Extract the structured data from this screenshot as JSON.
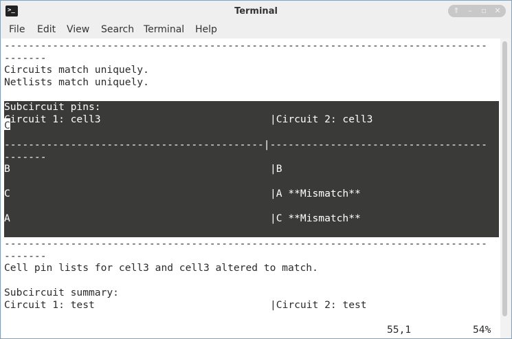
{
  "window": {
    "title": "Terminal",
    "icon": "terminal-icon"
  },
  "controls": {
    "up": "⇑",
    "minimize": "–",
    "maximize": "▫",
    "close": "✕"
  },
  "menu": [
    "File",
    "Edit",
    "View",
    "Search",
    "Terminal",
    "Help"
  ],
  "terminal": {
    "dash_row": "--------------------------------------------------------------------------------",
    "dash_tail": "-------",
    "circuits_match": "Circuits match uniquely.",
    "netlists_match": "Netlists match uniquely.",
    "subckt_pins": "Subcircuit pins:",
    "pins_header_left": "Circuit 1: cell3",
    "pins_header_right": "|Circuit 2: cell3",
    "pins_sep": "-------------------------------------------|------------------------------------",
    "pin_b_left": "B",
    "pin_b_right": "|B",
    "pin_c_left": "C",
    "pin_c_right": "|A **Mismatch**",
    "pin_a_left": "A",
    "pin_a_right": "|C **Mismatch**",
    "cell_pins_altered": "Cell pin lists for cell3 and cell3 altered to match.",
    "summary_title": "Subcircuit summary:",
    "summary_left": "Circuit 1: test",
    "summary_right": "|Circuit 2: test",
    "position": "55,1",
    "percent": "54%"
  }
}
